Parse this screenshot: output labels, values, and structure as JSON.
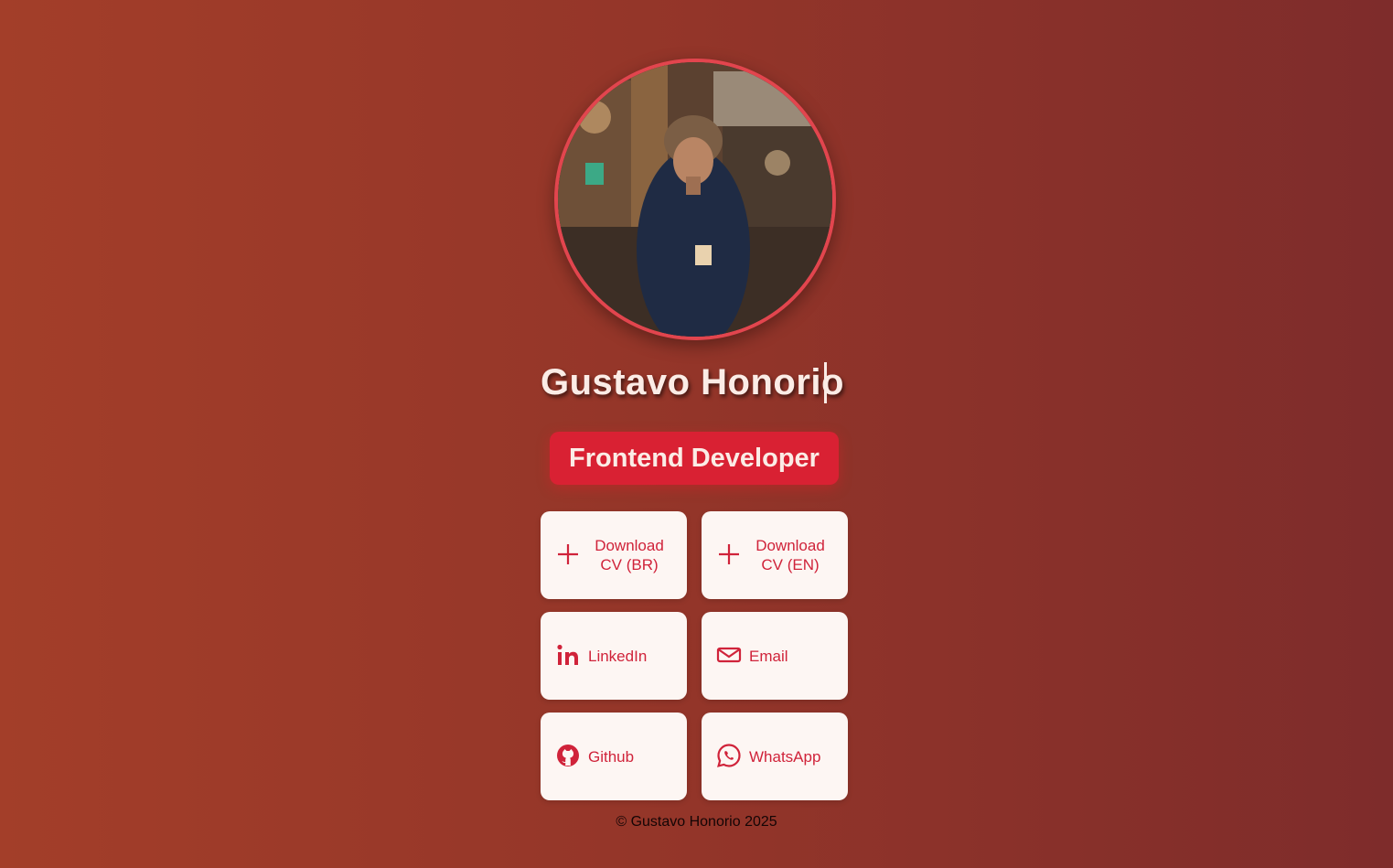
{
  "profile": {
    "name": "Gustavo Honorio",
    "role": "Frontend Developer",
    "avatar_alt": "profile photo"
  },
  "buttons": {
    "cv_br": {
      "label": "Download CV (BR)",
      "icon": "plus-icon"
    },
    "cv_en": {
      "label": "Download CV (EN)",
      "icon": "plus-icon"
    },
    "linkedin": {
      "label": "LinkedIn",
      "icon": "linkedin-icon"
    },
    "email": {
      "label": "Email",
      "icon": "envelope-icon"
    },
    "github": {
      "label": "Github",
      "icon": "github-icon"
    },
    "whatsapp": {
      "label": "WhatsApp",
      "icon": "whatsapp-icon"
    }
  },
  "footer": {
    "text": "© Gustavo Honorio 2025"
  },
  "colors": {
    "accent": "#d92133",
    "button_bg": "#fdf6f3",
    "button_text": "#d0233a",
    "background_start": "#a33e29",
    "background_end": "#7e2c2b"
  }
}
